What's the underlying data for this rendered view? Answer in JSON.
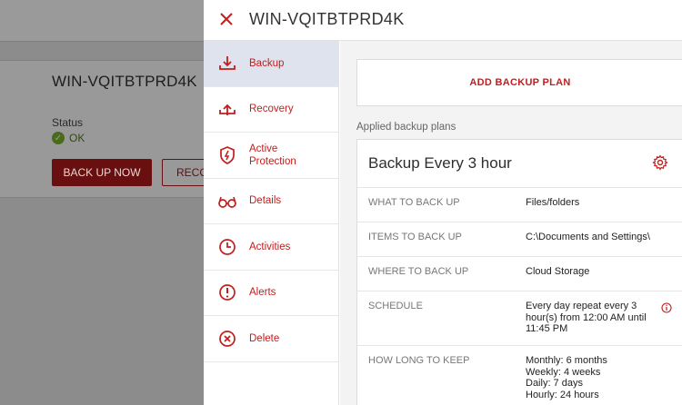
{
  "background": {
    "title": "WIN-VQITBTPRD4K",
    "status_label": "Status",
    "status_value": "OK",
    "backup_now": "BACK UP NOW",
    "recovery_partial": "RECO"
  },
  "drawer": {
    "title": "WIN-VQITBTPRD4K",
    "nav": [
      {
        "label": "Backup",
        "icon": "backup-icon"
      },
      {
        "label": "Recovery",
        "icon": "recovery-icon"
      },
      {
        "label": "Active\nProtection",
        "icon": "shield-icon"
      },
      {
        "label": "Details",
        "icon": "glasses-icon"
      },
      {
        "label": "Activities",
        "icon": "clock-icon"
      },
      {
        "label": "Alerts",
        "icon": "alert-icon"
      },
      {
        "label": "Delete",
        "icon": "delete-icon"
      }
    ],
    "add_plan": "ADD BACKUP PLAN",
    "applied_label": "Applied backup plans",
    "plan": {
      "title": "Backup Every 3 hour",
      "rows": [
        {
          "key": "WHAT TO BACK UP",
          "value": "Files/folders"
        },
        {
          "key": "ITEMS TO BACK UP",
          "value": "C:\\Documents and Settings\\"
        },
        {
          "key": "WHERE TO BACK UP",
          "value": "Cloud Storage"
        },
        {
          "key": "SCHEDULE",
          "value": "Every day repeat every 3 hour(s) from 12:00 AM until 11:45 PM"
        },
        {
          "key": "HOW LONG TO KEEP",
          "value": "Monthly: 6 months\nWeekly: 4 weeks\nDaily: 7 days\nHourly: 24 hours"
        }
      ]
    }
  },
  "colors": {
    "accent": "#c31d1d",
    "active_nav": "#dfe3ee"
  }
}
